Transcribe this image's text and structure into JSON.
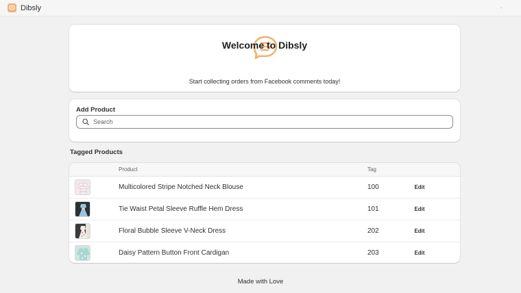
{
  "app": {
    "name": "Dibsly",
    "brand_color": "#f0b06c",
    "menu_dot": "."
  },
  "welcome": {
    "icon": "chat-bubble-icon",
    "title": "Welcome to Dibsly",
    "subtitle": "Start collecting orders from Facebook comments today!"
  },
  "add_product": {
    "title": "Add Product",
    "search_placeholder": "Search",
    "search_value": ""
  },
  "tagged_products": {
    "title": "Tagged Products",
    "columns": {
      "product": "Product",
      "tag": "Tag"
    },
    "rows": [
      {
        "name": "Multicolored Stripe Notched Neck Blouse",
        "tag": "100",
        "action": "Edit"
      },
      {
        "name": "Tie Waist Petal Sleeve Ruffle Hem Dress",
        "tag": "101",
        "action": "Edit"
      },
      {
        "name": "Floral Bubble Sleeve V-Neck Dress",
        "tag": "202",
        "action": "Edit"
      },
      {
        "name": "Daisy Pattern Button Front Cardigan",
        "tag": "203",
        "action": "Edit"
      }
    ]
  },
  "footer": {
    "text": "Made with Love"
  }
}
